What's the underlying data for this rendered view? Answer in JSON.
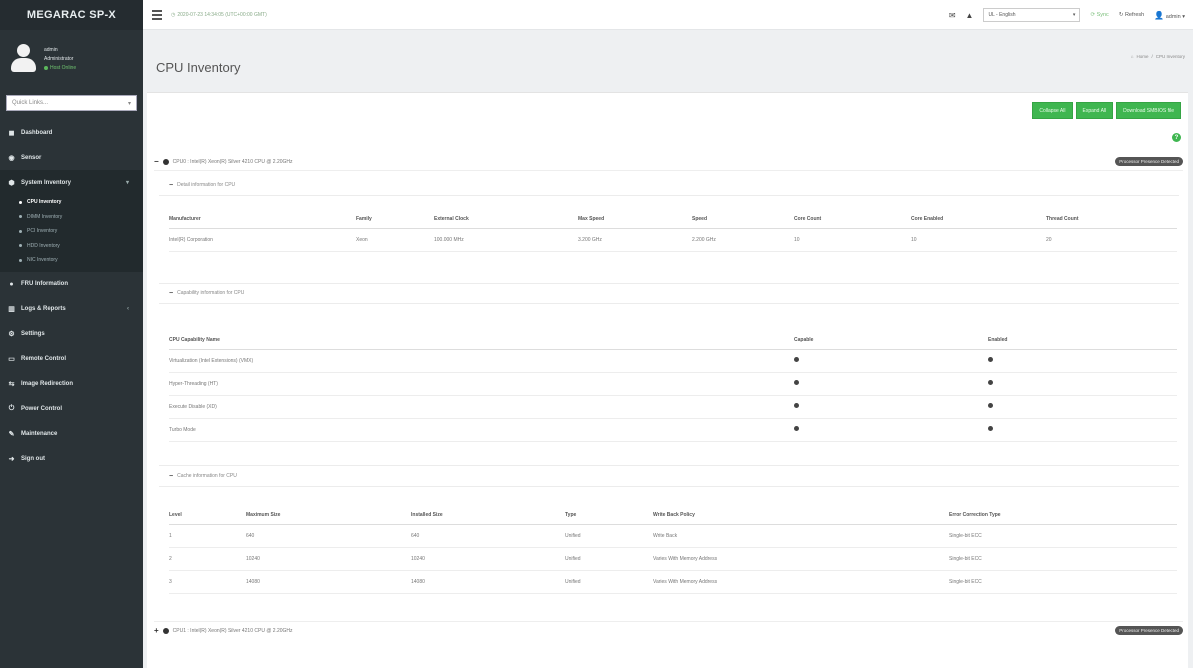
{
  "brand": "MEGARAC SP-X",
  "user": {
    "name": "admin",
    "role": "Administrator",
    "status": "Host Online"
  },
  "sidebar": {
    "quicklinks_placeholder": "Quick Links...",
    "items": [
      {
        "label": "Dashboard",
        "icon": "dashboard-icon"
      },
      {
        "label": "Sensor",
        "icon": "sensor-icon"
      },
      {
        "label": "System Inventory",
        "icon": "inventory-icon"
      },
      {
        "label": "FRU Information",
        "icon": "fru-icon"
      },
      {
        "label": "Logs & Reports",
        "icon": "chart-icon"
      },
      {
        "label": "Settings",
        "icon": "gear-icon"
      },
      {
        "label": "Remote Control",
        "icon": "monitor-icon"
      },
      {
        "label": "Image Redirection",
        "icon": "link-icon"
      },
      {
        "label": "Power Control",
        "icon": "power-icon"
      },
      {
        "label": "Maintenance",
        "icon": "wrench-icon"
      },
      {
        "label": "Sign out",
        "icon": "signout-icon"
      }
    ],
    "subitems": [
      "CPU Inventory",
      "DIMM Inventory",
      "PCI Inventory",
      "HDD Inventory",
      "NIC Inventory"
    ]
  },
  "topbar": {
    "datetime": "2020-07-23 14:34:05 (UTC+00:00 GMT)",
    "language": "UL - English",
    "sync": "Sync",
    "refresh": "Refresh",
    "user_menu": "admin"
  },
  "page": {
    "title": "CPU Inventory",
    "breadcrumb_home": "Home",
    "breadcrumb_current": "CPU Inventory",
    "buttons": {
      "collapse_all": "Collapse All",
      "expand_all": "Expand All",
      "download": "Download SMBIOS file"
    }
  },
  "cpu0": {
    "title": "CPU0 : Intel(R) Xeon(R) Silver 4210 CPU @ 2.20GHz",
    "badge": "Processor Presence Detected",
    "detail_section": "Detail information for CPU",
    "detail_headers": [
      "Manufacturer",
      "Family",
      "External Clock",
      "Max Speed",
      "Speed",
      "Core Count",
      "Core Enabled",
      "Thread Count"
    ],
    "detail_values": [
      "Intel(R) Corporation",
      "Xeon",
      "100.000 MHz",
      "3.200 GHz",
      "2.200 GHz",
      "10",
      "10",
      "20"
    ],
    "capability_section": "Capability information for CPU",
    "capability_headers": [
      "CPU Capability Name",
      "Capable",
      "Enabled"
    ],
    "capabilities": [
      "Virtualization (Intel Extensions) (VMX)",
      "Hyper-Threading (HT)",
      "Execute Disable (XD)",
      "Turbo Mode"
    ],
    "cache_section": "Cache information for CPU",
    "cache_headers": [
      "Level",
      "Maximum Size",
      "Installed Size",
      "Type",
      "Write Back Policy",
      "Error Correction Type"
    ],
    "cache_rows": [
      [
        "1",
        "640",
        "640",
        "Unified",
        "Write Back",
        "Single-bit ECC"
      ],
      [
        "2",
        "10240",
        "10240",
        "Unified",
        "Varies With Memory Address",
        "Single-bit ECC"
      ],
      [
        "3",
        "14080",
        "14080",
        "Unified",
        "Varies With Memory Address",
        "Single-bit ECC"
      ]
    ]
  },
  "cpu1": {
    "title": "CPU1 : Intel(R) Xeon(R) Silver 4210 CPU @ 2.20GHz",
    "badge": "Processor Presence Detected"
  }
}
